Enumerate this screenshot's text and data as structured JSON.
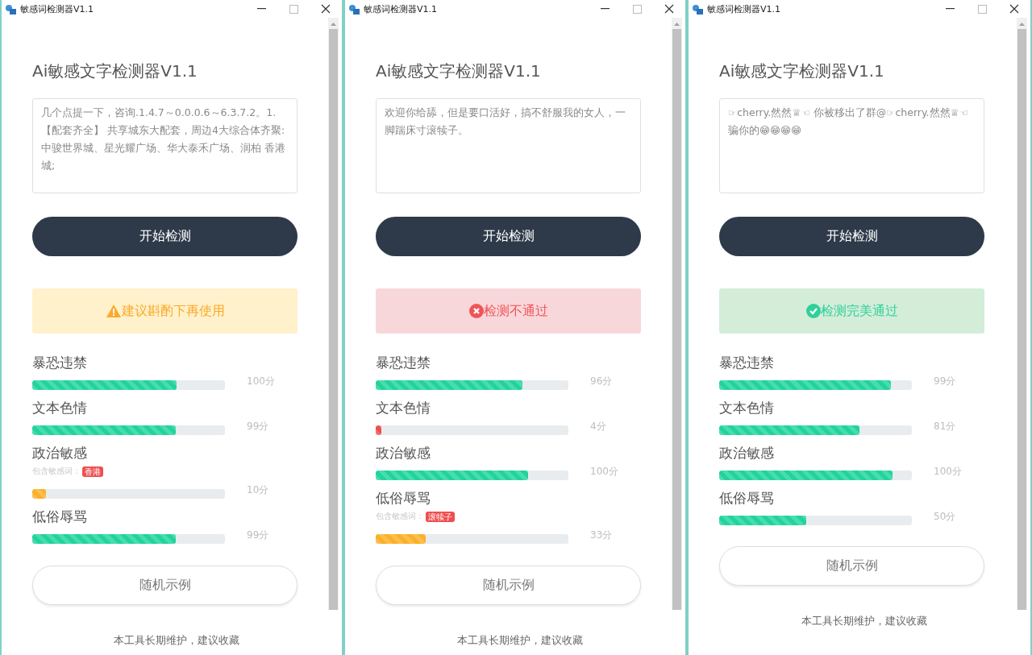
{
  "windows": [
    {
      "title": "敏感词检测器V1.1",
      "heading": "Ai敏感文字检测器V1.1",
      "input_text": "几个点提一下，咨询.1.4.7～0.0.0.6～6.3.7.2。1.【配套齐全】 共享城东大配套，周边4大综合体齐聚:中骏世界城、星光耀广场、华大泰禾广场、润柏 香港城;",
      "detect_button": "开始检测",
      "alert": {
        "kind": "warning",
        "text": "建议斟酌下再使用"
      },
      "scores": [
        {
          "label": "暴恐违禁",
          "level": 0.75,
          "color": "#20d49c",
          "score": "100分"
        },
        {
          "label": "文本色情",
          "level": 0.745,
          "color": "#20d49c",
          "score": "99分"
        },
        {
          "label": "政治敏感",
          "level": 0.07,
          "color": "#fbb027",
          "score": "10分",
          "keywords_label": "包含敏感词：",
          "keywords": [
            "香港"
          ]
        },
        {
          "label": "低俗辱骂",
          "level": 0.745,
          "color": "#20d49c",
          "score": "99分"
        }
      ],
      "random_button": "随机示例",
      "footer": "本工具长期维护，建议收藏"
    },
    {
      "title": "敏感词检测器V1.1",
      "heading": "Ai敏感文字检测器V1.1",
      "input_text": "欢迎你给舔，但是要口活好，搞不舒服我的女人，一脚踹床寸滚犊子。",
      "detect_button": "开始检测",
      "alert": {
        "kind": "error",
        "text": "检测不通过"
      },
      "scores": [
        {
          "label": "暴恐违禁",
          "level": 0.76,
          "color": "#20d49c",
          "score": "96分"
        },
        {
          "label": "文本色情",
          "level": 0.03,
          "color": "#ef4e4e",
          "score": "4分"
        },
        {
          "label": "政治敏感",
          "level": 0.79,
          "color": "#20d49c",
          "score": "100分"
        },
        {
          "label": "低俗辱骂",
          "level": 0.26,
          "color": "#fbb027",
          "score": "33分",
          "keywords_label": "包含敏感词：",
          "keywords": [
            "滚犊子"
          ]
        }
      ],
      "random_button": "随机示例",
      "footer": "本工具长期维护，建议收藏"
    },
    {
      "title": "敏感词检测器V1.1",
      "heading": "Ai敏感文字检测器V1.1",
      "input_text": "☞cherry.然然♕☜ 你被移出了群@☞cherry.然然♕☜ 骗你的😁😁😁😁",
      "detect_button": "开始检测",
      "alert": {
        "kind": "success",
        "text": "检测完美通过"
      },
      "scores": [
        {
          "label": "暴恐违禁",
          "level": 0.89,
          "color": "#20d49c",
          "score": "99分"
        },
        {
          "label": "文本色情",
          "level": 0.73,
          "color": "#20d49c",
          "score": "81分"
        },
        {
          "label": "政治敏感",
          "level": 0.9,
          "color": "#20d49c",
          "score": "100分"
        },
        {
          "label": "低俗辱骂",
          "level": 0.45,
          "color": "#20d49c",
          "score": "50分"
        }
      ],
      "random_button": "随机示例",
      "footer": "本工具长期维护，建议收藏"
    }
  ]
}
